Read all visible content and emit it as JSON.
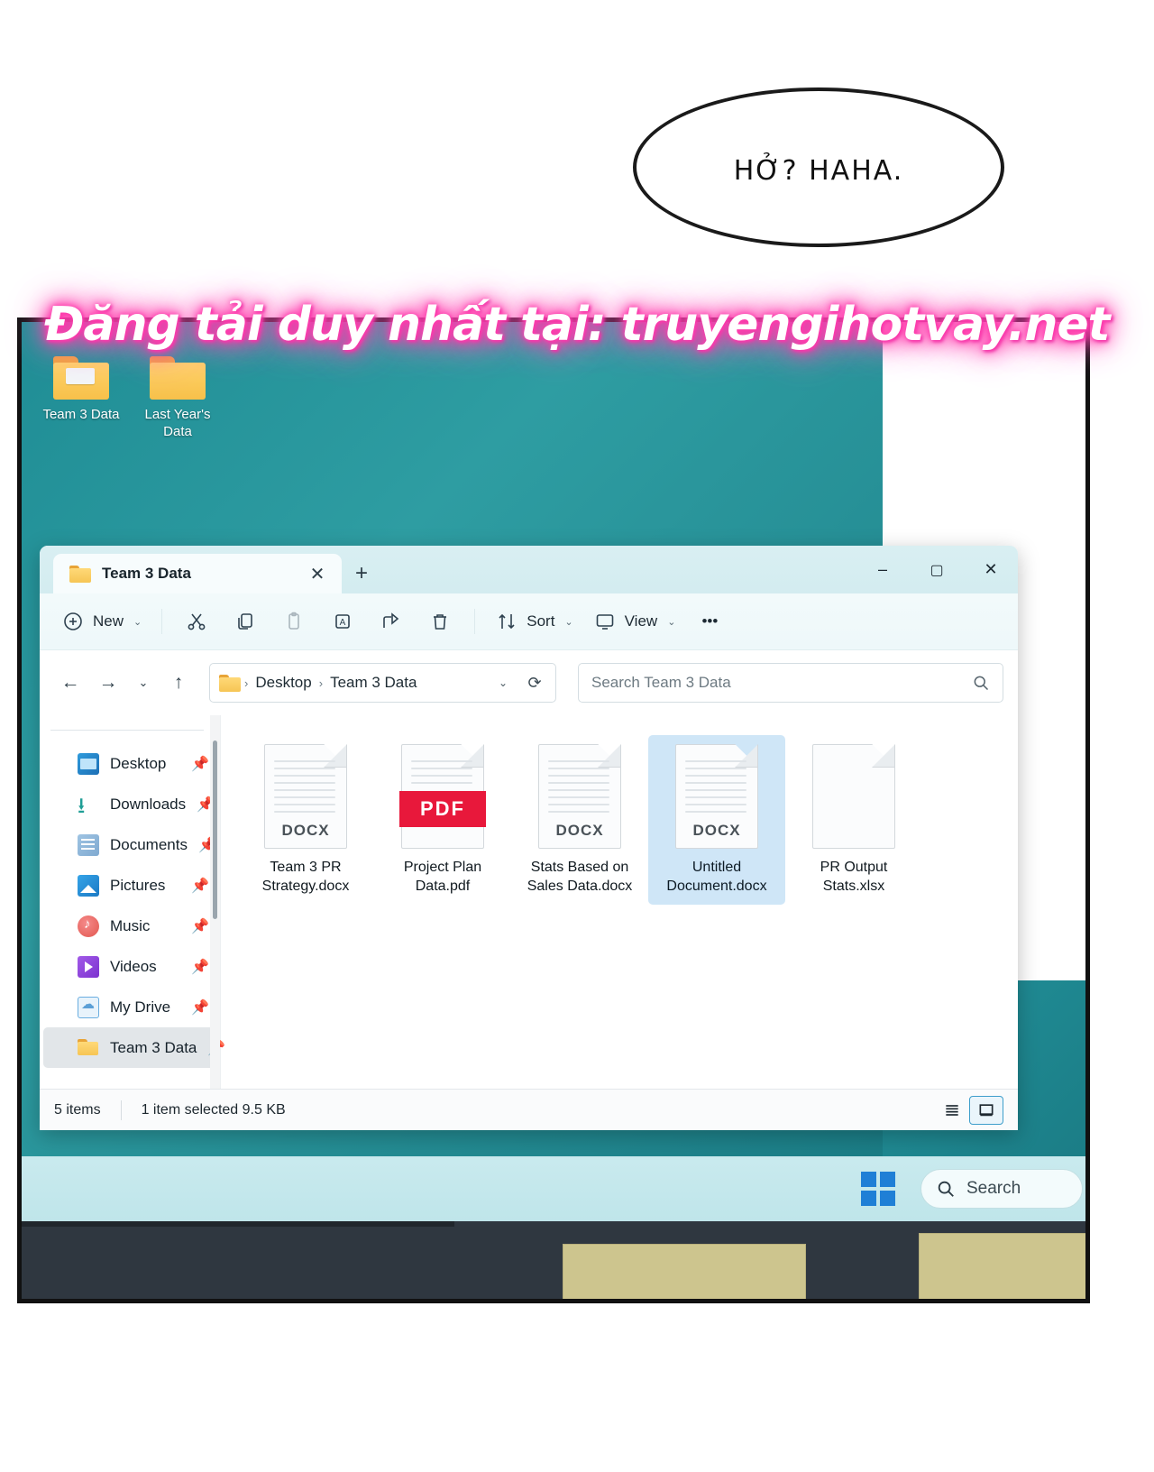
{
  "comic": {
    "speech_bubble": "HỞ? HAHA.",
    "watermark": "Đăng tải duy nhất tại: truyengihotvay.net"
  },
  "desktop": {
    "icons": [
      {
        "name": "Team 3 Data",
        "icon": "folder-with-file-icon"
      },
      {
        "name": "Last Year's Data",
        "icon": "folder-icon"
      }
    ]
  },
  "taskbar": {
    "start_label": "windows-logo-icon",
    "search_placeholder": "Search"
  },
  "explorer": {
    "tab": {
      "title": "Team 3 Data",
      "close": "✕",
      "new_tab": "+"
    },
    "window_controls": {
      "minimize": "–",
      "maximize": "▢",
      "close": "✕"
    },
    "ribbon": {
      "new_label": "New",
      "new_icon": "plus-circle-icon",
      "cut_icon": "scissors-icon",
      "copy_icon": "copy-icon",
      "paste_icon": "paste-icon",
      "rename_icon": "rename-icon",
      "share_icon": "share-icon",
      "delete_icon": "trash-icon",
      "sort_label": "Sort",
      "sort_icon": "sort-arrows-icon",
      "view_label": "View",
      "view_icon": "monitor-icon",
      "more_label": "•••",
      "chevron": "⌄"
    },
    "address": {
      "back": "←",
      "forward": "→",
      "recent": "⌄",
      "up": "↑",
      "crumb_root": "Desktop",
      "crumb_current": "Team 3 Data",
      "crumb_sep": "›",
      "dropdown": "⌄",
      "refresh": "⟳"
    },
    "search": {
      "placeholder": "Search Team 3 Data",
      "icon": "magnifier-icon",
      "value": ""
    },
    "sidebar": {
      "items": [
        {
          "label": "Desktop",
          "icon": "desktop-icon",
          "pinned": true,
          "selected": false
        },
        {
          "label": "Downloads",
          "icon": "download-icon",
          "pinned": true,
          "selected": false
        },
        {
          "label": "Documents",
          "icon": "documents-icon",
          "pinned": true,
          "selected": false
        },
        {
          "label": "Pictures",
          "icon": "pictures-icon",
          "pinned": true,
          "selected": false
        },
        {
          "label": "Music",
          "icon": "music-icon",
          "pinned": true,
          "selected": false
        },
        {
          "label": "Videos",
          "icon": "video-icon",
          "pinned": true,
          "selected": false
        },
        {
          "label": "My Drive",
          "icon": "cloud-drive-icon",
          "pinned": true,
          "selected": false
        },
        {
          "label": "Team 3 Data",
          "icon": "folder-icon",
          "pinned": true,
          "selected": true
        }
      ],
      "pin_glyph": "📌"
    },
    "files": [
      {
        "name_line1": "Team 3 PR",
        "name_line2": "Strategy.docx",
        "type": "DOCX",
        "selected": false
      },
      {
        "name_line1": "Project Plan",
        "name_line2": "Data.pdf",
        "type": "PDF",
        "selected": false
      },
      {
        "name_line1": "Stats Based on",
        "name_line2": "Sales Data.docx",
        "type": "DOCX",
        "selected": false
      },
      {
        "name_line1": "Untitled",
        "name_line2": "Document.docx",
        "type": "DOCX",
        "selected": true
      },
      {
        "name_line1": "PR Output",
        "name_line2": "Stats.xlsx",
        "type": "",
        "selected": false
      }
    ],
    "status": {
      "item_count": "5 items",
      "selection": "1 item selected  9.5 KB",
      "list_view_icon": "list-view-icon",
      "details_view_icon": "large-icons-view-icon"
    }
  },
  "colors": {
    "accent": "#1f8d95",
    "selection": "#cfe6f7",
    "pdf_red": "#e8183b",
    "watermark_glow": "#ff3fae"
  }
}
